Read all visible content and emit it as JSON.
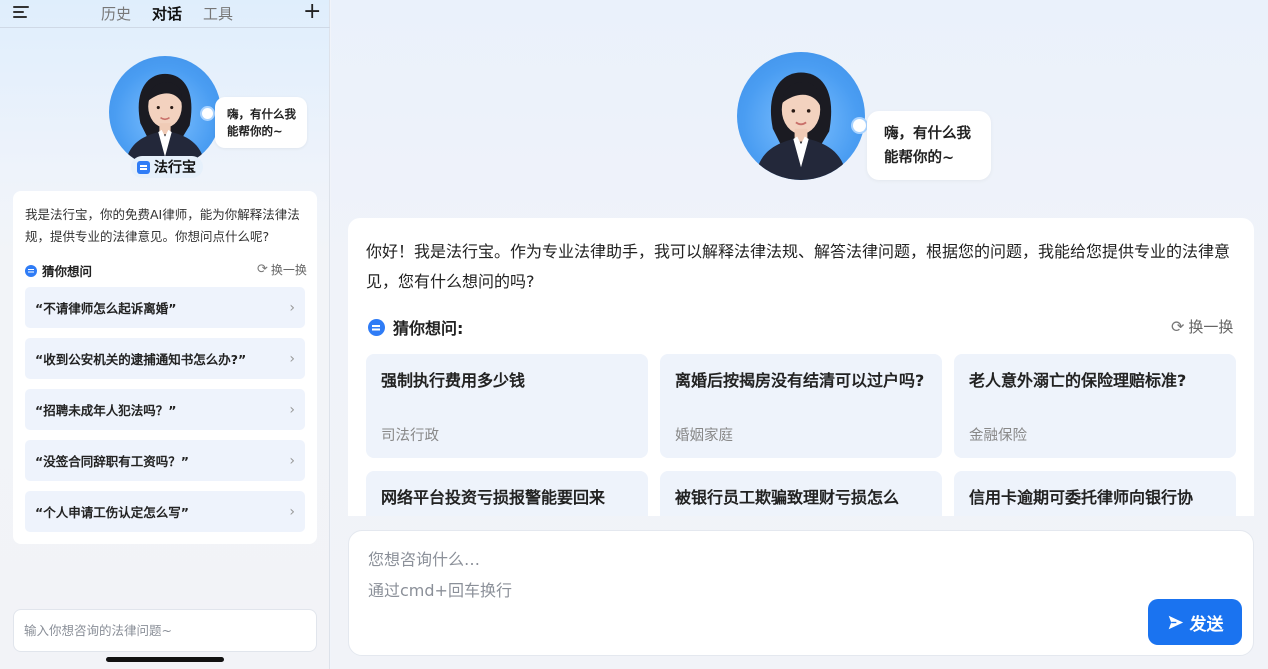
{
  "sidebar": {
    "tabs": [
      {
        "label": "历史"
      },
      {
        "label": "对话"
      },
      {
        "label": "工具"
      }
    ],
    "active_tab": "对话",
    "bubble": "嗨，有什么我能帮你的~",
    "brand_name": "法行宝",
    "intro": "我是法行宝，你的免费AI律师，能为你解释法律法规，提供专业的法律意见。你想问点什么呢?",
    "guess_title": "猜你想问",
    "refresh_label": "换一换",
    "suggestions": [
      "“不请律师怎么起诉离婚”",
      "“收到公安机关的逮捕通知书怎么办?”",
      "“招聘未成年人犯法吗？”",
      "“没签合同辞职有工资吗？”",
      "“个人申请工伤认定怎么写”"
    ],
    "input_placeholder": "输入你想咨询的法律问题~"
  },
  "main": {
    "bubble": "嗨，有什么我能帮你的~",
    "greeting": "你好！我是法行宝。作为专业法律助手，我可以解释法律法规、解答法律问题，根据您的问题，我能给您提供专业的法律意见，您有什么想问的吗?",
    "guess_title": "猜你想问:",
    "refresh_label": "换一换",
    "questions": [
      {
        "title": "强制执行费用多少钱",
        "category": "司法行政"
      },
      {
        "title": "离婚后按揭房没有结清可以过户吗?",
        "category": "婚姻家庭"
      },
      {
        "title": "老人意外溺亡的保险理赔标准?",
        "category": "金融保险"
      },
      {
        "title": "网络平台投资亏损报警能要回来",
        "category": ""
      },
      {
        "title": "被银行员工欺骗致理财亏损怎么",
        "category": ""
      },
      {
        "title": "信用卡逾期可委托律师向银行协",
        "category": ""
      }
    ],
    "compose_placeholder": "您想咨询什么…",
    "compose_hint": "通过cmd+回车换行",
    "send_label": "发送"
  },
  "colors": {
    "accent": "#1a73f0",
    "card_bg": "#eef3fb"
  }
}
